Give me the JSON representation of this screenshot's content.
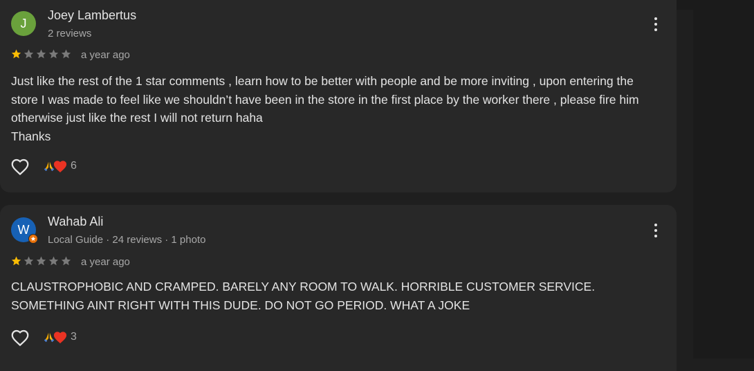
{
  "reviews": [
    {
      "avatar_letter": "J",
      "avatar_color": "#6aa13c",
      "name": "Joey Lambertus",
      "meta": "2 reviews",
      "rating": 1,
      "max_rating": 5,
      "time": "a year ago",
      "text": "Just like the rest of the 1 star comments , learn how to be better with people and be more inviting , upon entering the store I was made to feel like we shouldn’t have been in the store in the first place by the worker there , please fire him otherwise just like the rest I will not return haha\nThanks",
      "reaction_count": "6",
      "reactions": [
        "pray-icon",
        "heart-icon"
      ]
    },
    {
      "avatar_letter": "W",
      "avatar_color": "#1761b5",
      "local_guide": true,
      "name": "Wahab Ali",
      "meta": "Local Guide · 24 reviews · 1 photo",
      "rating": 1,
      "max_rating": 5,
      "time": "a year ago",
      "text": "CLAUSTROPHOBIC AND CRAMPED. BARELY ANY ROOM TO WALK. HORRIBLE CUSTOMER SERVICE. SOMETHING AINT RIGHT WITH THIS DUDE. DO NOT GO PERIOD. WHAT A JOKE",
      "reaction_count": "3",
      "reactions": [
        "pray-icon",
        "heart-icon"
      ]
    }
  ],
  "colors": {
    "star_filled": "#fbbc04",
    "star_empty": "#7a7a7a",
    "heart": "#ea3323",
    "local_guide_badge": "#e8710a"
  }
}
